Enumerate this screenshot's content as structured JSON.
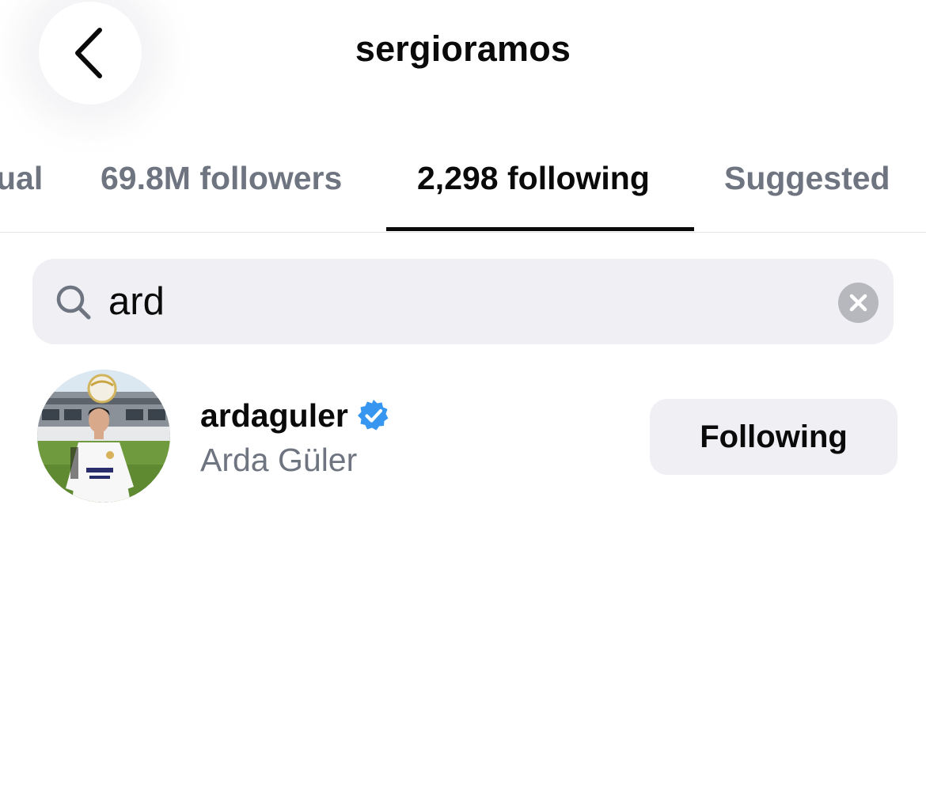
{
  "header": {
    "title": "sergioramos",
    "back_icon": "chevron-left-icon"
  },
  "tabs": [
    {
      "label": "ual",
      "active": false
    },
    {
      "label": "69.8M followers",
      "active": false
    },
    {
      "label": "2,298 following",
      "active": true
    },
    {
      "label": "Suggested",
      "active": false
    }
  ],
  "search": {
    "value": "ard",
    "icon": "search-icon",
    "clear_icon": "clear-icon"
  },
  "results": [
    {
      "username": "ardaguler",
      "verified": true,
      "full_name": "Arda Güler",
      "button_label": "Following"
    }
  ],
  "colors": {
    "primary_text": "#0a0a0a",
    "secondary_text": "#6e7480",
    "field_background": "#efeff4",
    "verified_blue": "#3797f0",
    "clear_gray": "#b7b8bd"
  }
}
